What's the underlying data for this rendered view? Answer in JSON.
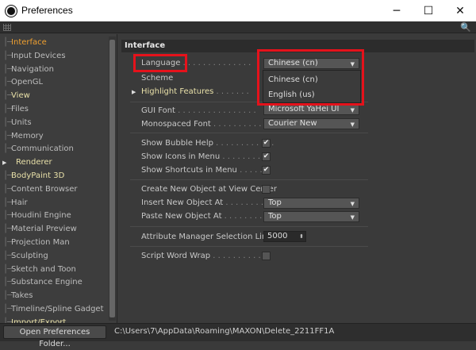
{
  "window": {
    "title": "Preferences",
    "minimize": "─",
    "maximize": "☐",
    "close": "✕"
  },
  "sidebar": {
    "items": [
      {
        "label": "Interface",
        "state": "active"
      },
      {
        "label": "Input Devices"
      },
      {
        "label": "Navigation"
      },
      {
        "label": "OpenGL"
      },
      {
        "label": "View",
        "state": "highlight"
      },
      {
        "label": "Files"
      },
      {
        "label": "Units"
      },
      {
        "label": "Memory"
      },
      {
        "label": "Communication"
      },
      {
        "label": "Renderer",
        "state": "highlight",
        "expandable": true
      },
      {
        "label": "BodyPaint 3D",
        "state": "highlight"
      },
      {
        "label": "Content Browser"
      },
      {
        "label": "Hair"
      },
      {
        "label": "Houdini Engine"
      },
      {
        "label": "Material Preview"
      },
      {
        "label": "Projection Man"
      },
      {
        "label": "Sculpting"
      },
      {
        "label": "Sketch and Toon"
      },
      {
        "label": "Substance Engine"
      },
      {
        "label": "Takes"
      },
      {
        "label": "Timeline/Spline Gadget"
      },
      {
        "label": "Import/Export",
        "state": "highlight"
      }
    ]
  },
  "panel": {
    "heading": "Interface",
    "language_label": "Language",
    "language_value": "Chinese (cn)",
    "language_options": [
      "Chinese (cn)",
      "English (us)"
    ],
    "scheme_label": "Scheme",
    "highlight_features_label": "Highlight Features",
    "gui_font_label": "GUI Font",
    "gui_font_value": "Microsoft YaHei UI",
    "mono_font_label": "Monospaced Font",
    "mono_font_value": "Courier New",
    "bubble_help_label": "Show Bubble Help",
    "bubble_help_checked": true,
    "icons_menu_label": "Show Icons in Menu",
    "icons_menu_checked": true,
    "shortcuts_menu_label": "Show Shortcuts in Menu",
    "shortcuts_menu_checked": true,
    "create_at_center_label": "Create New Object at View Center",
    "create_at_center_checked": false,
    "insert_new_label": "Insert New Object At",
    "insert_new_value": "Top",
    "paste_new_label": "Paste New Object At",
    "paste_new_value": "Top",
    "attr_limit_label": "Attribute Manager Selection Limit",
    "attr_limit_value": "5000",
    "word_wrap_label": "Script Word Wrap",
    "word_wrap_checked": false
  },
  "footer": {
    "open_folder_button": "Open Preferences Folder...",
    "path": "C:\\Users\\7\\AppData\\Roaming\\MAXON\\Delete_2211FF1A"
  },
  "icons": {
    "app": "cinema4d-logo-icon",
    "search": "search-icon",
    "grip": "grip-icon",
    "checkmark": "✔",
    "caret": "▼",
    "expand": "▶",
    "spin": "⬍"
  },
  "colors": {
    "annotation_red": "#e5121b",
    "active_item": "#f0a030",
    "highlight_item": "#e8e0a8"
  }
}
